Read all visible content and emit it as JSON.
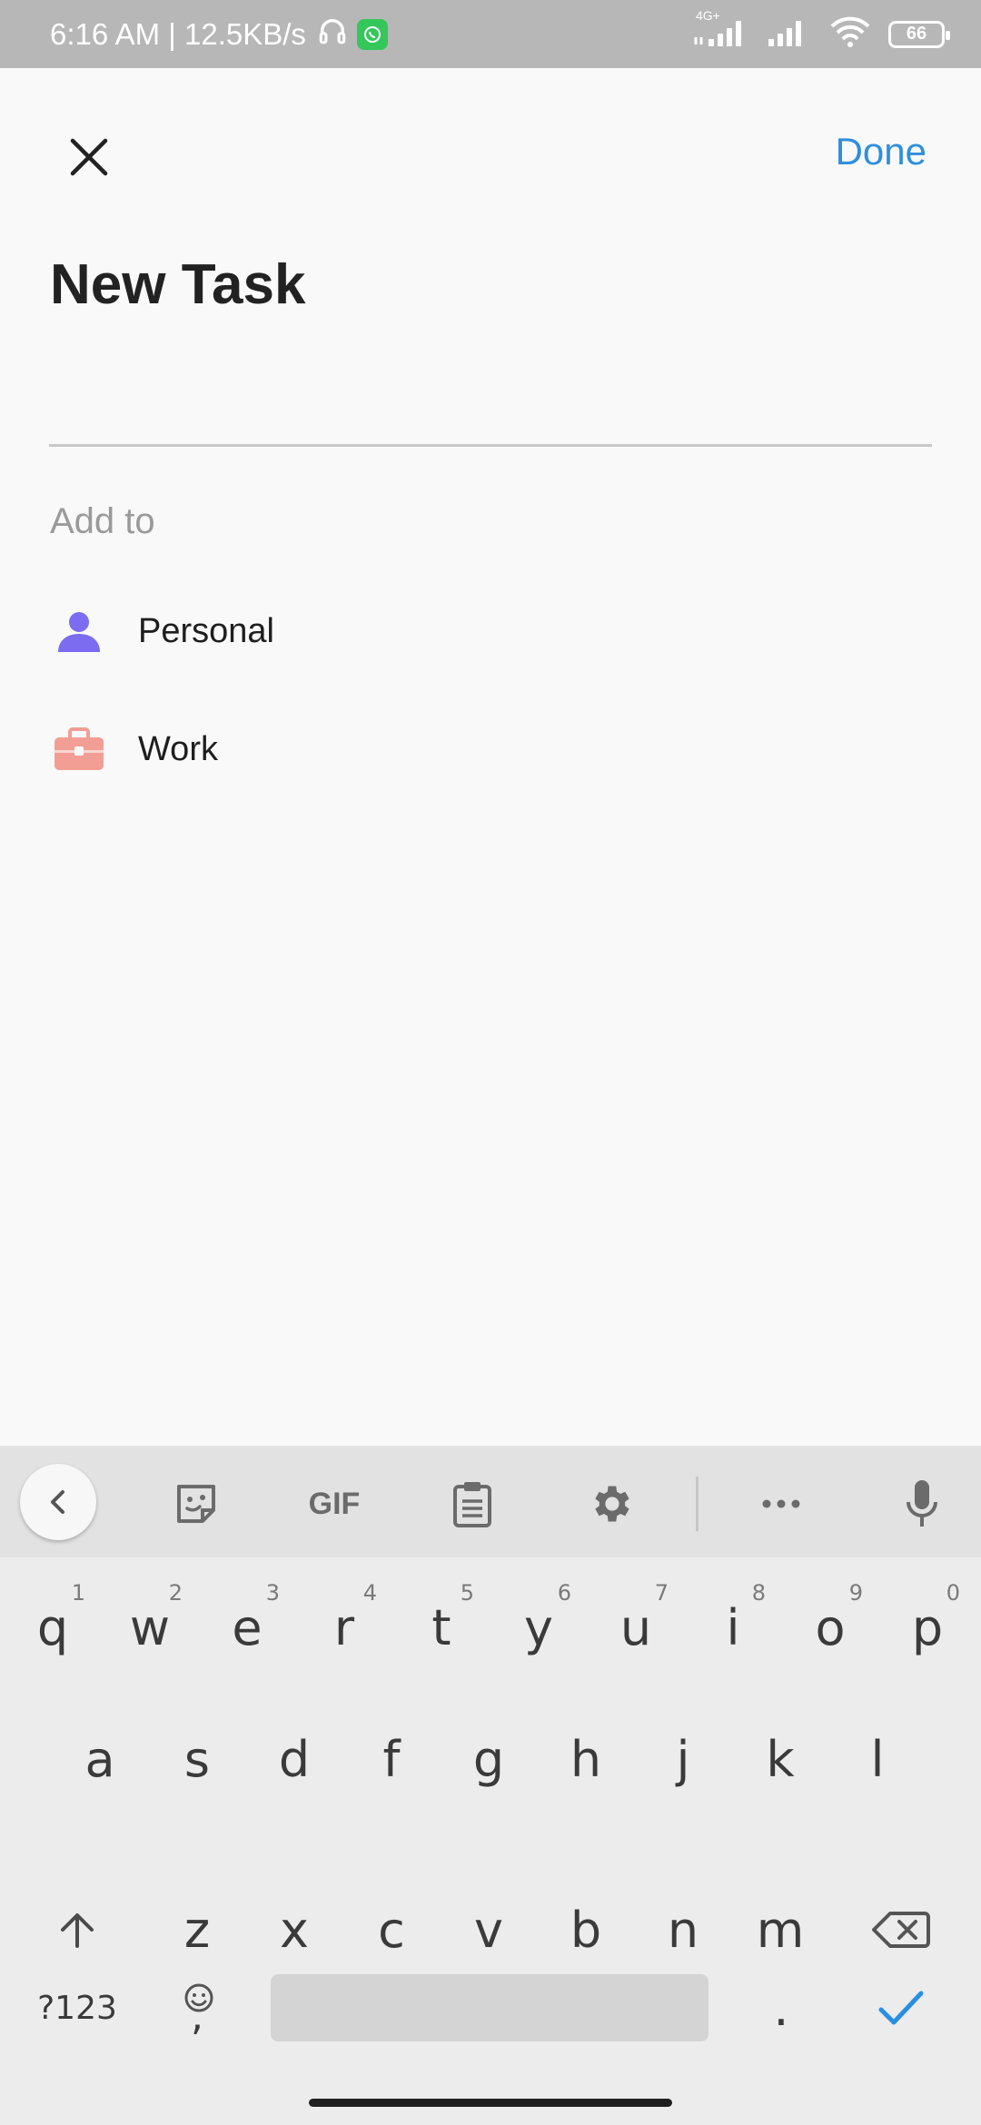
{
  "status_bar": {
    "time_speed": "6:16 AM | 12.5KB/s",
    "network": "4G+",
    "battery": "66"
  },
  "header": {
    "done_label": "Done",
    "title": "New Task"
  },
  "task_input": {
    "value": "",
    "placeholder": ""
  },
  "add_to": {
    "label": "Add to",
    "items": [
      {
        "label": "Personal",
        "icon": "person-icon",
        "color": "#7b6cf0"
      },
      {
        "label": "Work",
        "icon": "briefcase-icon",
        "color": "#f29e94"
      }
    ]
  },
  "keyboard": {
    "toolbar": {
      "gif_label": "GIF"
    },
    "row1": [
      {
        "char": "q",
        "hint": "1"
      },
      {
        "char": "w",
        "hint": "2"
      },
      {
        "char": "e",
        "hint": "3"
      },
      {
        "char": "r",
        "hint": "4"
      },
      {
        "char": "t",
        "hint": "5"
      },
      {
        "char": "y",
        "hint": "6"
      },
      {
        "char": "u",
        "hint": "7"
      },
      {
        "char": "i",
        "hint": "8"
      },
      {
        "char": "o",
        "hint": "9"
      },
      {
        "char": "p",
        "hint": "0"
      }
    ],
    "row2": [
      "a",
      "s",
      "d",
      "f",
      "g",
      "h",
      "j",
      "k",
      "l"
    ],
    "row3": [
      "z",
      "x",
      "c",
      "v",
      "b",
      "n",
      "m"
    ],
    "symbols_label": "?123",
    "comma_label": ",",
    "period_label": "."
  },
  "colors": {
    "accent": "#2f8fdc",
    "check": "#2b8fe0"
  }
}
